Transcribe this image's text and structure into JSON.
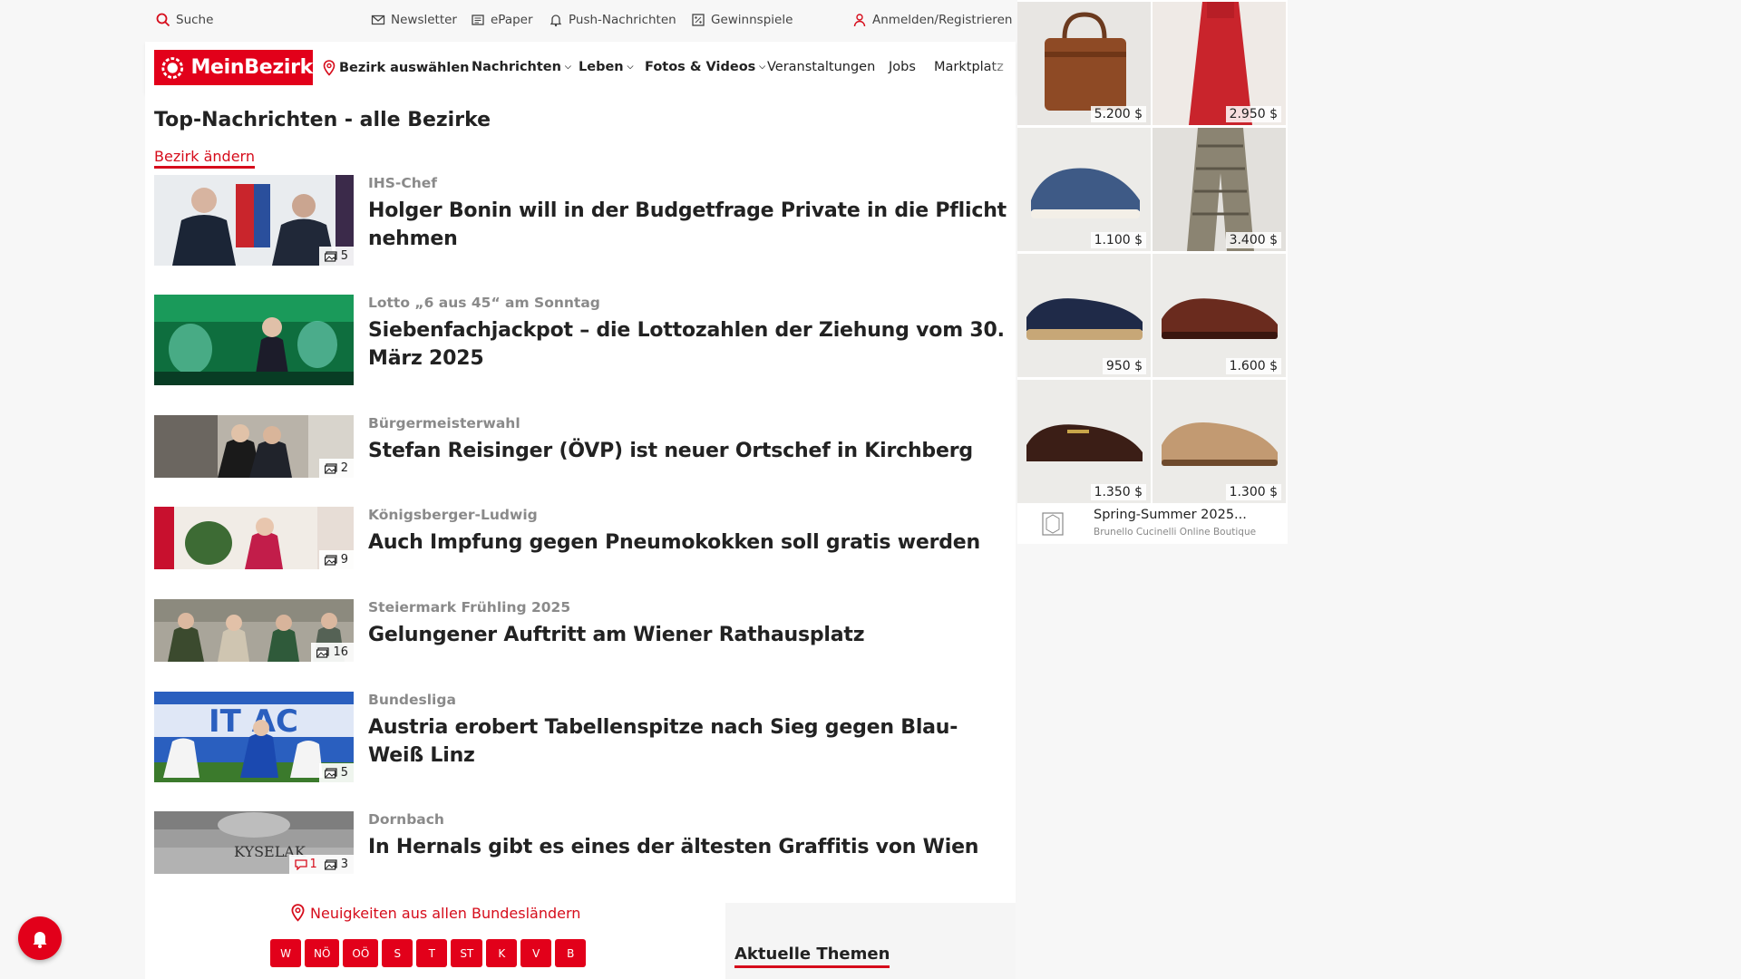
{
  "utility": {
    "search": "Suche",
    "newsletter": "Newsletter",
    "epaper": "ePaper",
    "push": "Push-Nachrichten",
    "games": "Gewinnspiele",
    "login": "Anmelden/Registrieren"
  },
  "nav": {
    "logo": "MeinBezirk",
    "district": "Bezirk auswählen",
    "news": "Nachrichten",
    "leben": "Leben",
    "fotos": "Fotos & Videos",
    "events": "Veranstaltungen",
    "jobs": "Jobs",
    "market": "Marktplatz"
  },
  "main": {
    "title": "Top-Nachrichten - alle Bezirke",
    "change_district": "Bezirk ändern"
  },
  "articles": [
    {
      "kicker": "IHS-Chef",
      "headline": "Holger Bonin will in der Budgetfrage Private in die Pflicht nehmen",
      "photos": "5",
      "comments": ""
    },
    {
      "kicker": "Lotto „6 aus 45“ am Sonntag",
      "headline": "Siebenfachjackpot – die Lottozahlen der Ziehung vom 30. März 2025",
      "photos": "",
      "comments": ""
    },
    {
      "kicker": "Bürgermeisterwahl",
      "headline": "Stefan Reisinger (ÖVP) ist neuer Ortschef in Kirchberg",
      "photos": "2",
      "comments": ""
    },
    {
      "kicker": "Königsberger-Ludwig",
      "headline": "Auch Impfung gegen Pneumokokken soll gratis werden",
      "photos": "9",
      "comments": ""
    },
    {
      "kicker": "Steiermark Frühling 2025",
      "headline": "Gelungener Auftritt am Wiener Rathausplatz",
      "photos": "16",
      "comments": ""
    },
    {
      "kicker": "Bundesliga",
      "headline": "Austria erobert Tabellenspitze nach Sieg gegen Blau-Weiß Linz",
      "photos": "5",
      "comments": ""
    },
    {
      "kicker": "Dornbach",
      "headline": "In Hernals gibt es eines der ältesten Graffitis von Wien",
      "photos": "3",
      "comments": "1"
    }
  ],
  "bottom": {
    "all_states": "Neuigkeiten aus allen Bundesländern",
    "states": [
      "W",
      "NÖ",
      "OÖ",
      "S",
      "T",
      "ST",
      "K",
      "V",
      "B"
    ],
    "themes_title": "Aktuelle Themen"
  },
  "ad": {
    "prices": [
      "5.200 $",
      "2.950 $",
      "1.100 $",
      "3.400 $",
      "950 $",
      "1.600 $",
      "1.350 $",
      "1.300 $"
    ],
    "name": "Spring-Summer 2025...",
    "sub": "Brunello Cucinelli Online Boutique"
  },
  "colors": {
    "brand": "#e2001a",
    "link": "#d60c1b"
  }
}
